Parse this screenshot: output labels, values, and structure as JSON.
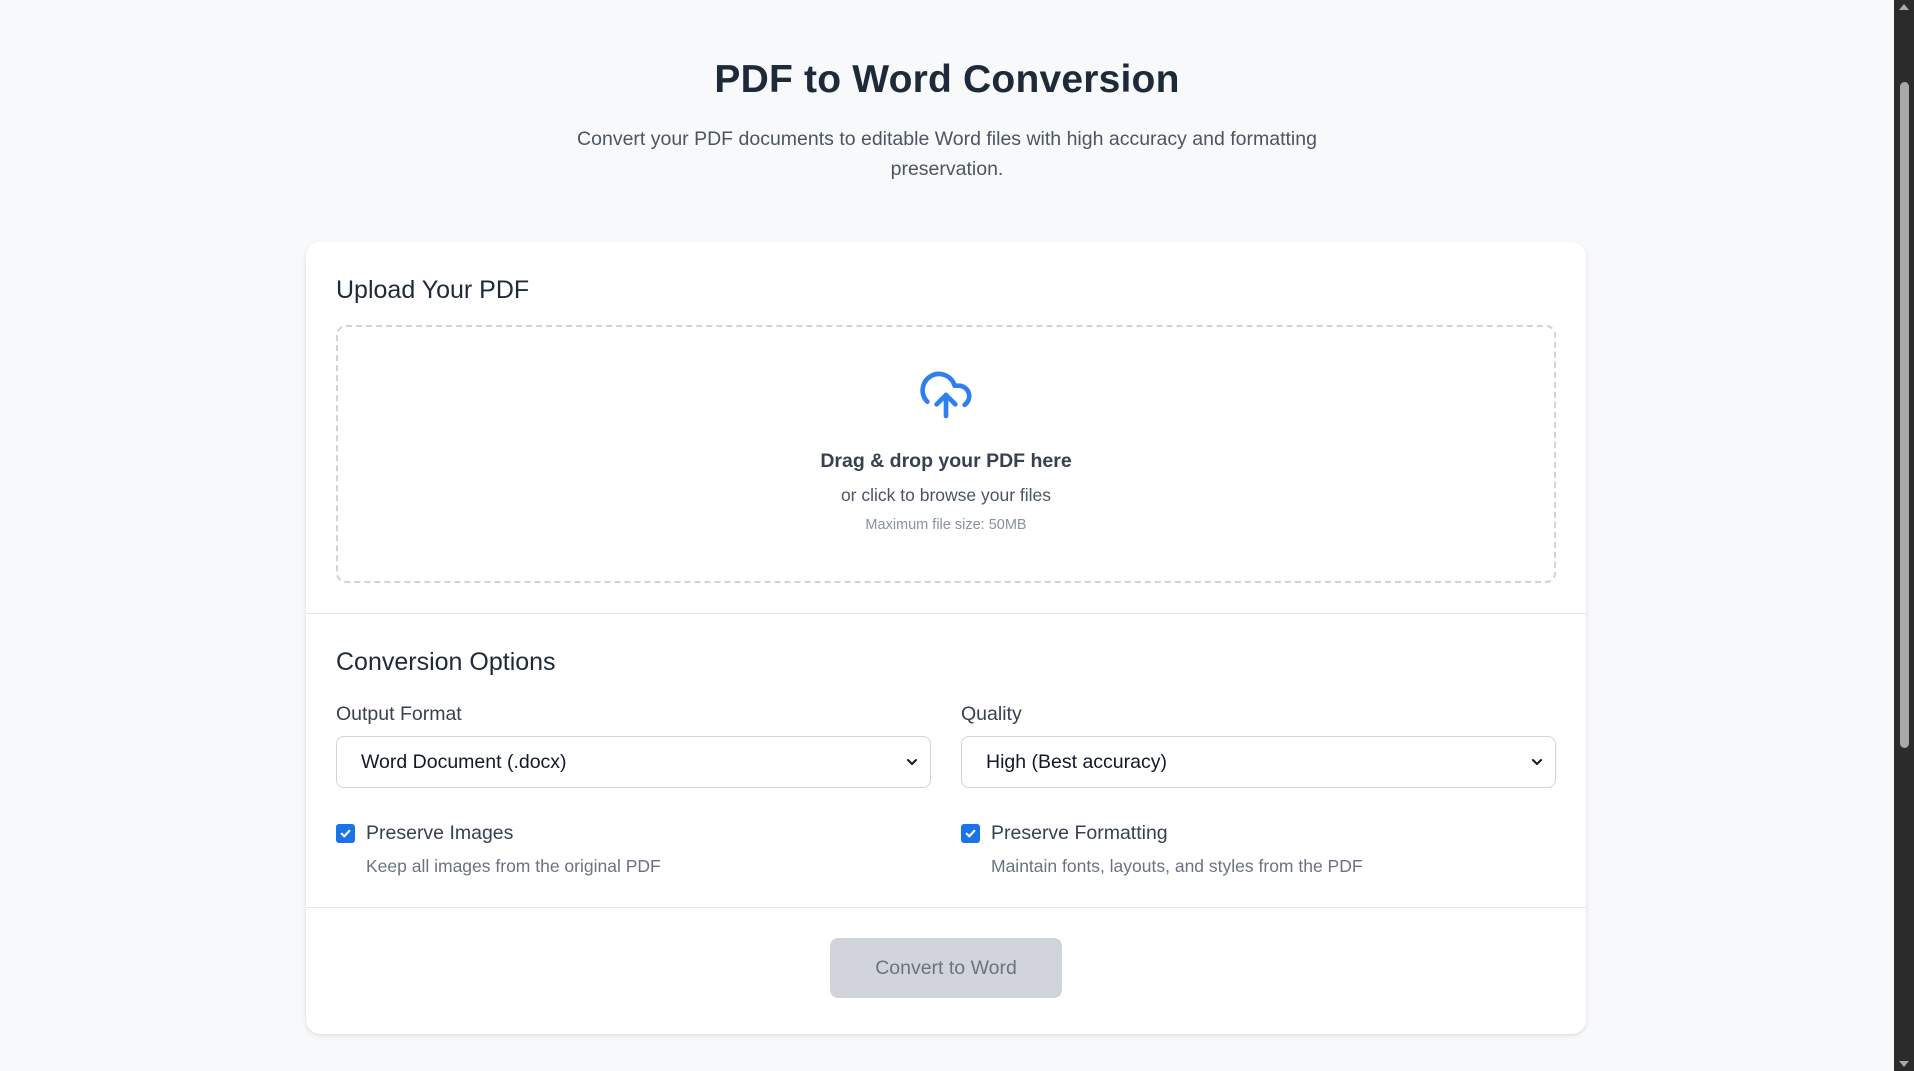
{
  "hero": {
    "title": "PDF to Word Conversion",
    "subtitle": "Convert your PDF documents to editable Word files with high accuracy and formatting preservation."
  },
  "upload": {
    "section_title": "Upload Your PDF",
    "icon": "cloud-upload-icon",
    "drop_title": "Drag & drop your PDF here",
    "drop_sub": "or click to browse your files",
    "max_size": "Maximum file size: 50MB"
  },
  "options": {
    "section_title": "Conversion Options",
    "output_format": {
      "label": "Output Format",
      "selected": "Word Document (.docx)"
    },
    "quality": {
      "label": "Quality",
      "selected": "High (Best accuracy)"
    },
    "preserve_images": {
      "label": "Preserve Images",
      "description": "Keep all images from the original PDF",
      "checked": true
    },
    "preserve_formatting": {
      "label": "Preserve Formatting",
      "description": "Maintain fonts, layouts, and styles from the PDF",
      "checked": true
    }
  },
  "actions": {
    "convert_label": "Convert to Word"
  },
  "colors": {
    "accent": "#1a73e8",
    "background": "#f8f9fb",
    "card": "#ffffff",
    "button_disabled": "#d1d5db"
  }
}
